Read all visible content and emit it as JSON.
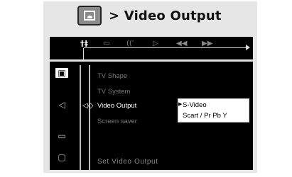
{
  "header": {
    "icon": "video-screen-icon",
    "title": "> Video Output"
  },
  "topbar": {
    "tabs": [
      {
        "label": "†‡",
        "icon": "settings-tab-icon",
        "active": true
      },
      {
        "label": "▭",
        "icon": "subtitle-tab-icon",
        "active": false
      },
      {
        "label": "((ʿ",
        "icon": "audio-tab-icon",
        "active": false
      },
      {
        "label": "▷",
        "icon": "play-tab-icon",
        "active": false
      },
      {
        "label": "◀◀",
        "icon": "rewind-tab-icon",
        "active": false
      },
      {
        "label": "▶▶",
        "icon": "forward-tab-icon",
        "active": false
      }
    ]
  },
  "sidebar": {
    "items": [
      {
        "glyph": "▣",
        "icon": "video-setup-icon",
        "active": true
      },
      {
        "glyph": "◁",
        "icon": "speaker-icon",
        "active": false
      },
      {
        "glyph": "▭",
        "icon": "subtitle-icon",
        "active": false
      },
      {
        "glyph": "▢",
        "icon": "preferences-icon",
        "active": false
      }
    ]
  },
  "menu": {
    "items": [
      {
        "label": "TV Shape",
        "active": false
      },
      {
        "label": "TV System",
        "active": false
      },
      {
        "label": "Video Output",
        "active": true
      },
      {
        "label": "Screen saver",
        "active": false
      }
    ],
    "nav_glyph": "◁◇"
  },
  "submenu": {
    "options": [
      {
        "label": "S-Video",
        "selected": true
      },
      {
        "label": "Scart / Pr Pb Y",
        "selected": false
      }
    ]
  },
  "hint": "Set  Video  Output"
}
